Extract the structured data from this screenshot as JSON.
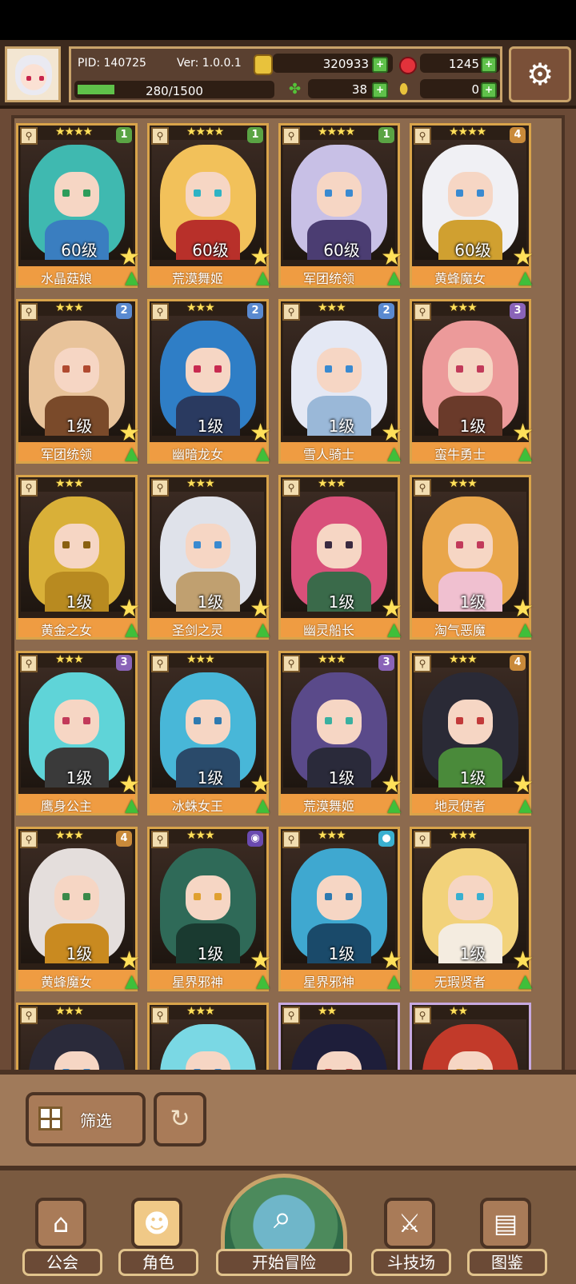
{
  "header": {
    "pid_label": "PID: 140725",
    "version_label": "Ver: 1.0.0.1",
    "gold": "320933",
    "gems": "1245",
    "xp_text": "280/1500",
    "xp_progress": 0.19,
    "clover": "38",
    "tokens": "0",
    "plus": "+",
    "settings_icon": "gear-icon"
  },
  "cards": [
    {
      "level": "60级",
      "name": "水晶菇娘",
      "stars": "★★★★",
      "badge": "1",
      "badge_color": "#5aa444",
      "hair": "#3fb9b0",
      "eye": "#2e9c5a",
      "body": "#3a7ec0"
    },
    {
      "level": "60级",
      "name": "荒漠舞姬",
      "stars": "★★★★",
      "badge": "1",
      "badge_color": "#5aa444",
      "hair": "#f2c15a",
      "eye": "#2fb3c4",
      "body": "#b8302a"
    },
    {
      "level": "60级",
      "name": "军团统领",
      "stars": "★★★★",
      "badge": "1",
      "badge_color": "#5aa444",
      "hair": "#c8c0e6",
      "eye": "#3a8ad0",
      "body": "#4b3d72"
    },
    {
      "level": "60级",
      "name": "黄蜂魔女",
      "stars": "★★★★",
      "badge": "4",
      "badge_color": "#c98a3a",
      "hair": "#f0f0f4",
      "eye": "#3a8ad0",
      "body": "#d0a030"
    },
    {
      "level": "1级",
      "name": "军团统领",
      "stars": "★★★",
      "badge": "2",
      "badge_color": "#5a8ad0",
      "hair": "#e8c39a",
      "eye": "#b04a30",
      "body": "#7a4a2a"
    },
    {
      "level": "1级",
      "name": "幽暗龙女",
      "stars": "★★★",
      "badge": "2",
      "badge_color": "#5a8ad0",
      "hair": "#2f7ec6",
      "eye": "#c82a50",
      "body": "#2a3a60"
    },
    {
      "level": "1级",
      "name": "雪人骑士",
      "stars": "★★★",
      "badge": "2",
      "badge_color": "#5a8ad0",
      "hair": "#e4e8f4",
      "eye": "#3a8ad0",
      "body": "#9ab8d8"
    },
    {
      "level": "1级",
      "name": "蛮牛勇士",
      "stars": "★★★",
      "badge": "3",
      "badge_color": "#8a64b8",
      "hair": "#ec9a9a",
      "eye": "#c23a5a",
      "body": "#6a3a2a"
    },
    {
      "level": "1级",
      "name": "黄金之女",
      "stars": "★★★",
      "badge": "",
      "badge_color": "",
      "hair": "#d9b038",
      "eye": "#8a6010",
      "body": "#b88a20"
    },
    {
      "level": "1级",
      "name": "圣剑之灵",
      "stars": "★★★",
      "badge": "",
      "badge_color": "",
      "hair": "#dfe2ea",
      "eye": "#3a8ad0",
      "body": "#c0a070"
    },
    {
      "level": "1级",
      "name": "幽灵船长",
      "stars": "★★★",
      "badge": "",
      "badge_color": "",
      "hair": "#d9507a",
      "eye": "#3a2a40",
      "body": "#3a6a4a"
    },
    {
      "level": "1级",
      "name": "淘气恶魔",
      "stars": "★★★",
      "badge": "",
      "badge_color": "",
      "hair": "#e9a64a",
      "eye": "#c23a5a",
      "body": "#f0c0d0"
    },
    {
      "level": "1级",
      "name": "鹰身公主",
      "stars": "★★★",
      "badge": "3",
      "badge_color": "#8a64b8",
      "hair": "#5fd4d8",
      "eye": "#c23a5a",
      "body": "#3a3a3a"
    },
    {
      "level": "1级",
      "name": "冰蛛女王",
      "stars": "★★★",
      "badge": "",
      "badge_color": "",
      "hair": "#48b7d8",
      "eye": "#2e7ab0",
      "body": "#2a4a6a"
    },
    {
      "level": "1级",
      "name": "荒漠舞姬",
      "stars": "★★★",
      "badge": "3",
      "badge_color": "#8a64b8",
      "hair": "#5a4a8a",
      "eye": "#3ab0a0",
      "body": "#2a2a3a"
    },
    {
      "level": "1级",
      "name": "地灵使者",
      "stars": "★★★",
      "badge": "4",
      "badge_color": "#c98a3a",
      "hair": "#2a2a36",
      "eye": "#c23a3a",
      "body": "#4a8a3a"
    },
    {
      "level": "1级",
      "name": "黄蜂魔女",
      "stars": "★★★",
      "badge": "4",
      "badge_color": "#c98a3a",
      "hair": "#e4dedc",
      "eye": "#3a8a4a",
      "body": "#c98a20"
    },
    {
      "level": "1级",
      "name": "星界邪神",
      "stars": "★★★",
      "badge": "◉",
      "badge_color": "#6a4ab0",
      "hair": "#2f6a58",
      "eye": "#e0a030",
      "body": "#1a3a30"
    },
    {
      "level": "1级",
      "name": "星界邪神",
      "stars": "★★★",
      "badge": "●",
      "badge_color": "#3ab0d0",
      "hair": "#3fa8d0",
      "eye": "#2e7ab0",
      "body": "#1a4a6a"
    },
    {
      "level": "1级",
      "name": "无瑕贤者",
      "stars": "★★★",
      "badge": "",
      "badge_color": "",
      "hair": "#f2d27a",
      "eye": "#3ab0d0",
      "body": "#f4ece0"
    },
    {
      "level": "",
      "name": "",
      "stars": "★★★",
      "badge": "",
      "badge_color": "",
      "hair": "#2a2a3a",
      "eye": "#3a8ad0",
      "body": "#2a2a3a"
    },
    {
      "level": "",
      "name": "",
      "stars": "★★★",
      "badge": "",
      "badge_color": "",
      "hair": "#7ad8e4",
      "eye": "#3a8ad0",
      "body": "#5ac0d0"
    },
    {
      "level": "",
      "name": "",
      "stars": "★★",
      "badge": "",
      "badge_color": "",
      "hair": "#1e1e3a",
      "eye": "#c23a3a",
      "body": "#3a7a3a",
      "rare": true
    },
    {
      "level": "",
      "name": "",
      "stars": "★★",
      "badge": "",
      "badge_color": "",
      "hair": "#c23a2a",
      "eye": "#e0a030",
      "body": "#6a2a2a",
      "rare": true
    }
  ],
  "controls": {
    "filter_label": "筛选",
    "filter_icon": "grid-icon",
    "refresh_icon": "refresh-icon"
  },
  "nav": {
    "guild_label": "公会",
    "role_label": "角色",
    "adventure_label": "开始冒险",
    "arena_label": "斗技场",
    "codex_label": "图鉴",
    "active": "role"
  }
}
